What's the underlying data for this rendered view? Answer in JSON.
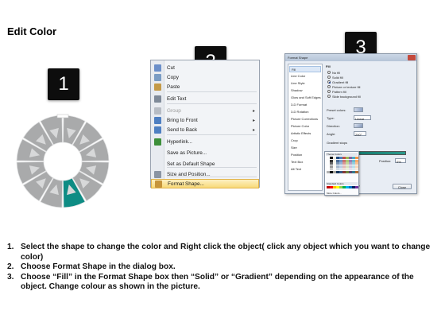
{
  "title": "Edit Color",
  "steps_badges": [
    "1",
    "2",
    "3"
  ],
  "context_menu": {
    "items": [
      {
        "label": "Cut",
        "icon": "scissors-icon",
        "color": "#6b8fc9",
        "disabled": false,
        "submenu": false
      },
      {
        "label": "Copy",
        "icon": "copy-icon",
        "color": "#7a9cc4",
        "disabled": false,
        "submenu": false
      },
      {
        "label": "Paste",
        "icon": "paste-icon",
        "color": "#c49a48",
        "disabled": false,
        "submenu": false
      },
      {
        "label": "Edit Text",
        "icon": "edit-text-icon",
        "color": "#7f8a99",
        "disabled": false,
        "submenu": false
      },
      {
        "label": "Group",
        "icon": "group-icon",
        "color": "#b7bcc4",
        "disabled": true,
        "submenu": true
      },
      {
        "label": "Bring to Front",
        "icon": "bring-front-icon",
        "color": "#4e7fc2",
        "disabled": false,
        "submenu": true
      },
      {
        "label": "Send to Back",
        "icon": "send-back-icon",
        "color": "#4e7fc2",
        "disabled": false,
        "submenu": true
      },
      {
        "label": "Hyperlink...",
        "icon": "hyperlink-icon",
        "color": "#3d8f3a",
        "disabled": false,
        "submenu": false
      },
      {
        "label": "Save as Picture...",
        "icon": "",
        "color": "",
        "disabled": false,
        "submenu": false
      },
      {
        "label": "Set as Default Shape",
        "icon": "",
        "color": "",
        "disabled": false,
        "submenu": false
      },
      {
        "label": "Size and Position...",
        "icon": "size-position-icon",
        "color": "#8a94a3",
        "disabled": false,
        "submenu": false
      },
      {
        "label": "Format Shape...",
        "icon": "format-shape-icon",
        "color": "#c6943a",
        "disabled": false,
        "submenu": false,
        "highlighted": true
      }
    ]
  },
  "format_dialog": {
    "title": "Format Shape",
    "categories": [
      "Fill",
      "Line Color",
      "Line Style",
      "Shadow",
      "Glow and Soft Edges",
      "3-D Format",
      "3-D Rotation",
      "Picture Corrections",
      "Picture Color",
      "Artistic Effects",
      "Crop",
      "Size",
      "Position",
      "Text Box",
      "Alt Text"
    ],
    "section_title": "Fill",
    "fill_options": [
      {
        "label": "No fill",
        "selected": false
      },
      {
        "label": "Solid fill",
        "selected": false
      },
      {
        "label": "Gradient fill",
        "selected": true
      },
      {
        "label": "Picture or texture fill",
        "selected": false
      },
      {
        "label": "Pattern fill",
        "selected": false
      },
      {
        "label": "Slide background fill",
        "selected": false
      }
    ],
    "preset_label": "Preset colors:",
    "type_label": "Type:",
    "type_value": "Linear",
    "direction_label": "Direction:",
    "angle_label": "Angle:",
    "angle_value": "290°",
    "gradient_stops_label": "Gradient stops",
    "color_label": "Color",
    "position_label": "Position:",
    "position_value": "0%",
    "brightness_label": "Brightness:",
    "transparency_label": "Transparency:",
    "rotate_label": "Rotate with shape",
    "theme_colors_label": "Theme Colors",
    "standard_colors_label": "Standard Colors",
    "more_colors_label": "More Colors...",
    "close_label": "Close",
    "gradient_color": "#0c6a5f"
  },
  "instructions": [
    {
      "num": "1.",
      "text": "Select the shape to change the color and Right click the object( click any object which you want to change color)"
    },
    {
      "num": "2.",
      "text": "Choose Format Shape in the dialog box."
    },
    {
      "num": "3.",
      "text": "Choose “Fill” in the Format Shape box then “Solid” or “Gradient” depending on the appearance of the object. Change colour as shown in the picture."
    }
  ],
  "diagram": {
    "highlight_color": "#0e8c84",
    "segment_color": "#a9aaab",
    "arrow_color": "#d7d8d9"
  }
}
